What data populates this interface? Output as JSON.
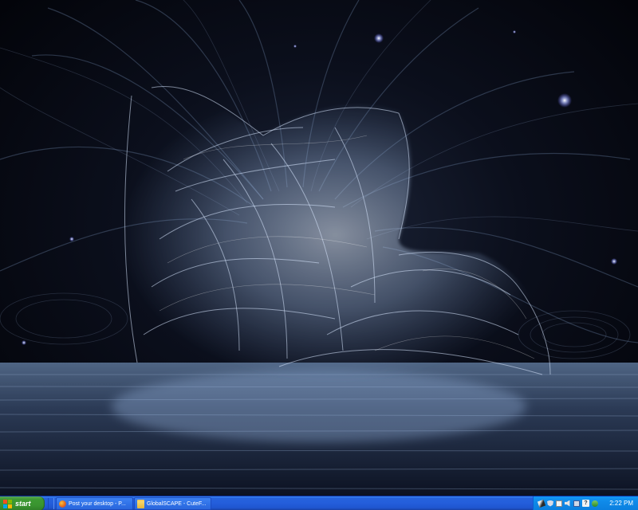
{
  "taskbar": {
    "start_label": "start",
    "tasks": [
      {
        "label": "Post your desktop - P...",
        "icon": "firefox-icon"
      },
      {
        "label": "GlobalSCAPE - CuteF...",
        "icon": "folder-icon"
      }
    ],
    "tray": {
      "icons": [
        "pen-tablet-icon",
        "shield-icon",
        "mail-icon",
        "speaker-icon",
        "network-icon",
        "help-icon",
        "safely-remove-icon"
      ],
      "help_glyph": "?",
      "clock": "2:22 PM"
    }
  },
  "colors": {
    "taskbar_blue": "#245edb",
    "start_green": "#3a9530",
    "tray_blue": "#0f8ae9",
    "wallpaper_glow": "#b9d6ff"
  }
}
